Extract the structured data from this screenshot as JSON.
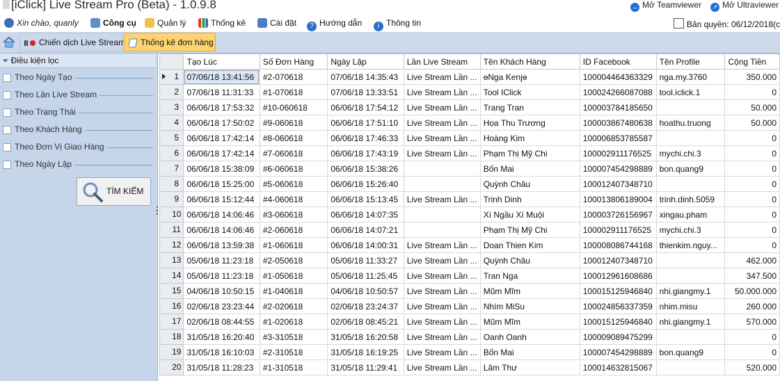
{
  "window": {
    "title": "[iClick] Live Stream Pro (Beta) - 1.0.9.8",
    "remote_links": [
      "Mở Teamviewer",
      "Mở Ultraviewer"
    ]
  },
  "menu": {
    "greeting": "Xin chào, quanly",
    "items": [
      "Công cụ",
      "Quản lý",
      "Thống kê",
      "Cài đặt",
      "Hướng dẫn",
      "Thông tin"
    ],
    "license": "Bản quyền: 06/12/2018(c"
  },
  "tabs": [
    "Chiến dịch Live Stream",
    "Thống kê đơn hàng"
  ],
  "filters": {
    "header": "Điều kiện lọc",
    "items": [
      "Theo Ngày Tạo",
      "Theo Lần Live Stream",
      "Theo Trạng Thái",
      "Theo Khách Hàng",
      "Theo Đơn Vị Giao Hàng",
      "Theo Ngày Lập"
    ],
    "search_button": "TÌM KIẾM"
  },
  "table": {
    "columns": [
      "Tạo Lúc",
      "Số Đơn Hàng",
      "Ngày Lập",
      "Lần Live Stream",
      "Tên Khách Hàng",
      "ID Facebook",
      "Tên Profile",
      "Cộng Tiền"
    ],
    "rows": [
      [
        "07/06/18 13:41:56",
        "#2-070618",
        "07/06/18 14:35:43",
        "Live Stream Lần ...",
        "ɵNga Kenjɵ",
        "100004464363329",
        "nga.my.3760",
        "350.000"
      ],
      [
        "07/06/18 11:31:33",
        "#1-070618",
        "07/06/18 13:33:51",
        "Live Stream Lần ...",
        "Tool IClick",
        "100024266087088",
        "tool.iclick.1",
        "0"
      ],
      [
        "06/06/18 17:53:32",
        "#10-060618",
        "06/06/18 17:54:12",
        "Live Stream Lần ...",
        "Trang Tran",
        "100003784185650",
        "",
        "50.000"
      ],
      [
        "06/06/18 17:50:02",
        "#9-060618",
        "06/06/18 17:51:10",
        "Live Stream Lần ...",
        "Họa Thu Trương",
        "100003867480638",
        "hoathu.truong",
        "50.000"
      ],
      [
        "06/06/18 17:42:14",
        "#8-060618",
        "06/06/18 17:46:33",
        "Live Stream Lần ...",
        "Hoàng Kim",
        "100006853785587",
        "",
        "0"
      ],
      [
        "06/06/18 17:42:14",
        "#7-060618",
        "06/06/18 17:43:19",
        "Live Stream Lần ...",
        "Phạm Thị Mỹ Chi",
        "100002911176525",
        "mychi.chi.3",
        "0"
      ],
      [
        "06/06/18 15:38:09",
        "#6-060618",
        "06/06/18 15:38:26",
        "",
        "Bốn Mai",
        "100007454298889",
        "bon.quang9",
        "0"
      ],
      [
        "06/06/18 15:25:00",
        "#5-060618",
        "06/06/18 15:26:40",
        "",
        "Quỳnh Châu",
        "100012407348710",
        "",
        "0"
      ],
      [
        "06/06/18 15:12:44",
        "#4-060618",
        "06/06/18 15:13:45",
        "Live Stream Lần ...",
        "Trinh Dinh",
        "100013806189004",
        "trinh.dinh.5059",
        "0"
      ],
      [
        "06/06/18 14:06:46",
        "#3-060618",
        "06/06/18 14:07:35",
        "",
        "Xí Ngầu Xí Muội",
        "100003726156967",
        "xingau.pham",
        "0"
      ],
      [
        "06/06/18 14:06:46",
        "#2-060618",
        "06/06/18 14:07:21",
        "",
        "Phạm Thị Mỹ Chi",
        "100002911176525",
        "mychi.chi.3",
        "0"
      ],
      [
        "06/06/18 13:59:38",
        "#1-060618",
        "06/06/18 14:00:31",
        "Live Stream Lần ...",
        "Doan Thien Kim",
        "100008086744168",
        "thienkim.nguy...",
        "0"
      ],
      [
        "05/06/18 11:23:18",
        "#2-050618",
        "05/06/18 11:33:27",
        "Live Stream Lần ...",
        "Quỳnh Châu",
        "100012407348710",
        "",
        "462.000"
      ],
      [
        "05/06/18 11:23:18",
        "#1-050618",
        "05/06/18 11:25:45",
        "Live Stream Lần ...",
        "Tran Nga",
        "100012961608686",
        "",
        "347.500"
      ],
      [
        "04/06/18 10:50:15",
        "#1-040618",
        "04/06/18 10:50:57",
        "Live Stream Lần ...",
        "Mũm Mĩm",
        "100015125946840",
        "nhi.giangmy.1",
        "50.000.000"
      ],
      [
        "02/06/18 23:23:44",
        "#2-020618",
        "02/06/18 23:24:37",
        "Live Stream Lần ...",
        "Nhím MiSu",
        "100024856337359",
        "nhim.misu",
        "260.000"
      ],
      [
        "02/06/18 08:44:55",
        "#1-020618",
        "02/06/18 08:45:21",
        "Live Stream Lần ...",
        "Mũm Mĩm",
        "100015125946840",
        "nhi.giangmy.1",
        "570.000"
      ],
      [
        "31/05/18 16:20:40",
        "#3-310518",
        "31/05/18 16:20:58",
        "Live Stream Lần ...",
        "Oanh Oanh",
        "100009089475299",
        "",
        "0"
      ],
      [
        "31/05/18 16:10:03",
        "#2-310518",
        "31/05/18 16:19:25",
        "Live Stream Lần ...",
        "Bốn Mai",
        "100007454298889",
        "bon.quang9",
        "0"
      ],
      [
        "31/05/18 11:28:23",
        "#1-310518",
        "31/05/18 11:29:41",
        "Live Stream Lần ...",
        "Lâm Thư",
        "100014632815067",
        "",
        "520.000"
      ]
    ]
  }
}
